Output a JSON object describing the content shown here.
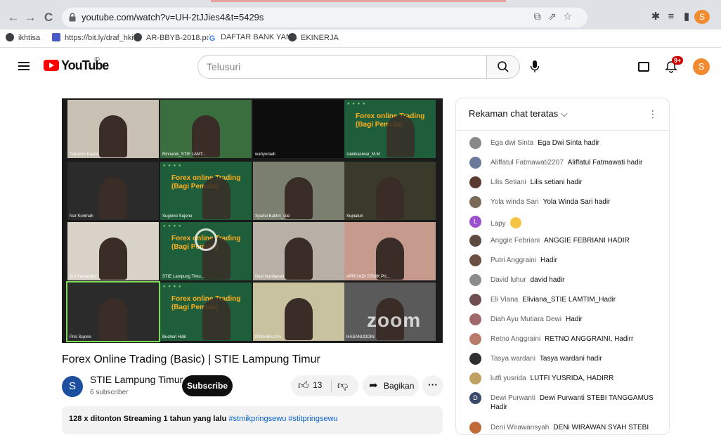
{
  "browser": {
    "url": "youtube.com/watch?v=UH-2tJJies4&t=5429s",
    "profile_initial": "S",
    "bookmarks": [
      {
        "label": "ikhtisa",
        "color": "#3c4043"
      },
      {
        "label": "https://bit.ly/draf_hki",
        "color": "#4a5cc4"
      },
      {
        "label": "AR-BBYB-2018.pdf",
        "color": "#3c4043"
      },
      {
        "label": "DAFTAR BANK YAN...",
        "color": "#4285f4"
      },
      {
        "label": "EKINERJA",
        "color": "#3c4043"
      }
    ]
  },
  "header": {
    "logo_text": "YouTube",
    "logo_region": "ID",
    "search_placeholder": "Telusuri",
    "notif_badge": "9+",
    "avatar_initial": "S"
  },
  "video": {
    "title": "Forex Online Trading (Basic) | STIE Lampung Timur",
    "zoom_watermark": "zoom",
    "slide_text": "Forex online Trading (Bagi Pemula)",
    "participants": [
      {
        "name": "Tukasno Kasno",
        "kind": "person",
        "bg": "#c9c2b4"
      },
      {
        "name": "Rinnanik_STIE LAMT...",
        "kind": "person",
        "bg": "#3b6e3f"
      },
      {
        "name": "wahyuriadi",
        "kind": "blank",
        "bg": "#0d0d0d"
      },
      {
        "name": "zainikasiwar_M.M",
        "kind": "slide",
        "bg": "#1f5e3b"
      },
      {
        "name": "Nur Korimah",
        "kind": "person",
        "bg": "#2b2b2b"
      },
      {
        "name": "Sugiono Sujono",
        "kind": "slide",
        "bg": "#1f5e3b"
      },
      {
        "name": "Syaiful Bakhri_stie",
        "kind": "person",
        "bg": "#7a7f70"
      },
      {
        "name": "Supiatun",
        "kind": "person",
        "bg": "#3a3a2a"
      },
      {
        "name": "Arif Setiawann",
        "kind": "person",
        "bg": "#d8d2c8"
      },
      {
        "name": "STIE Lampung Timu...",
        "kind": "slide",
        "bg": "#1f5e3b"
      },
      {
        "name": "Desi Nurdianati",
        "kind": "person",
        "bg": "#b8b0a6"
      },
      {
        "name": "APRIYADI STMIK Pri...",
        "kind": "person",
        "bg": "#c79a8e"
      },
      {
        "name": "Prio Sujono",
        "kind": "person",
        "bg": "#2b2b2b"
      },
      {
        "name": "Buchori Holil",
        "kind": "slide",
        "bg": "#1f5e3b"
      },
      {
        "name": "RINA MALIYA",
        "kind": "person",
        "bg": "#c9c2a0"
      },
      {
        "name": "HASANUDDIN",
        "kind": "person",
        "bg": "#5a5a5a"
      }
    ]
  },
  "channel": {
    "initial": "S",
    "name": "STIE Lampung Timur",
    "subscribers": "6 subscriber",
    "subscribe_label": "Subscribe"
  },
  "actions": {
    "likes": "13",
    "share_label": "Bagikan",
    "more_label": "···"
  },
  "description": {
    "views": "128 x ditonton",
    "meta": "Streaming 1 tahun yang lalu",
    "tags": "#stmikpringsewu #stitpringsewu"
  },
  "chat": {
    "title": "Rekaman chat teratas",
    "messages": [
      {
        "author": "Ega dwi Sinta",
        "text": "Ega Dwi Sinta hadir",
        "color": "#8a8a8a"
      },
      {
        "author": "Aliffatul Fatmawati2207",
        "text": "Aliffatul Fatmawati hadir",
        "color": "#6b7a9a"
      },
      {
        "author": "Lilis Setiani",
        "text": "Lilis setiani hadir",
        "color": "#5a3a2e"
      },
      {
        "author": "Yola winda Sari",
        "text": "Yola Winda Sari hadir",
        "color": "#7a6a5a"
      },
      {
        "author": "Lapy",
        "text": "",
        "color": "#9c4fcf",
        "initial": "L",
        "emoji": true
      },
      {
        "author": "Anggie Febriani",
        "text": "ANGGIE FEBRIANI HADIR",
        "color": "#5e4a3e"
      },
      {
        "author": "Putri Anggraini",
        "text": "Hadir",
        "color": "#6a5040"
      },
      {
        "author": "David luhur",
        "text": "david hadir",
        "color": "#8c8c8c"
      },
      {
        "author": "Eli Viana",
        "text": "Eliviana_STIE LAMTIM_Hadir",
        "color": "#6e4e4e"
      },
      {
        "author": "Diah Ayu Mutiara Dewi",
        "text": "Hadir",
        "color": "#a0686a"
      },
      {
        "author": "Retno Anggraini",
        "text": "RETNO ANGGRAINI, Hadirr",
        "color": "#b87a6a"
      },
      {
        "author": "Tasya wardani",
        "text": "Tasya wardani hadir",
        "color": "#2e2e2e"
      },
      {
        "author": "lutfi yusrida",
        "text": "LUTFI YUSRIDA, HADIRR",
        "color": "#c0a060"
      },
      {
        "author": "Dewi Purwanti",
        "text": "Dewi Purwanti STEBI TANGGAMUS Hadir",
        "color": "#3a4a6a",
        "initial": "D",
        "two": true
      },
      {
        "author": "Deni Wirawansyah",
        "text": "DENi WIRAWAN SYAH STEBI",
        "color": "#c06a3a"
      }
    ]
  }
}
